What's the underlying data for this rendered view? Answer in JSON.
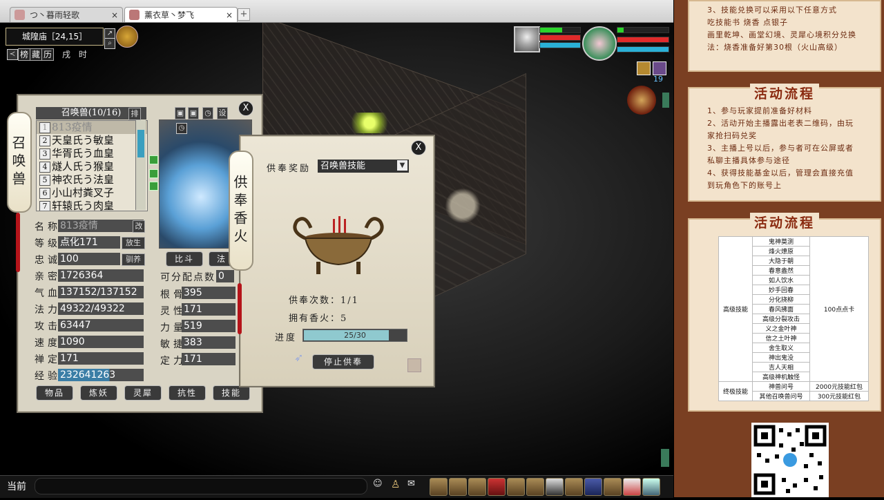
{
  "browser": {
    "tabs": [
      {
        "label": "つ丶暮雨轻歌"
      },
      {
        "label": "薰衣草丶梦飞"
      }
    ],
    "new_tab": "+"
  },
  "hud": {
    "location": "城隍庙［24,15］",
    "shortcut_labels": [
      "榜",
      "藏",
      "历"
    ],
    "game_time": "戌 时",
    "pet_level_badge": "19"
  },
  "summon_panel": {
    "scroll_title": "召唤兽",
    "list_header": "召唤兽(10/16)",
    "sort_btn": "排",
    "lock_icons": [
      "▣",
      "▣",
      "◷",
      "设"
    ],
    "pets": [
      {
        "num": "1",
        "name": "813疫情"
      },
      {
        "num": "2",
        "name": "天皇氏う敏皇"
      },
      {
        "num": "3",
        "name": "华胥氏う血皇"
      },
      {
        "num": "4",
        "name": "燧人氏う猴皇"
      },
      {
        "num": "5",
        "name": "神农氏う法皇"
      },
      {
        "num": "6",
        "name": "小山村粪叉子"
      },
      {
        "num": "7",
        "name": "轩辕氏う肉皇"
      }
    ],
    "attrs_left": [
      {
        "label": "名称",
        "value": "813疫情",
        "btn": "改"
      },
      {
        "label": "等级",
        "value": "点化171",
        "btn": "放生"
      },
      {
        "label": "忠诚",
        "value": "100",
        "btn": "驯养"
      },
      {
        "label": "亲密",
        "value": "1726364"
      },
      {
        "label": "气血",
        "value": "137152/137152"
      },
      {
        "label": "法力",
        "value": "49322/49322"
      },
      {
        "label": "攻击",
        "value": "63447"
      },
      {
        "label": "速度",
        "value": "1090"
      },
      {
        "label": "禅定",
        "value": "171"
      },
      {
        "label": "经验",
        "value": "232641263"
      }
    ],
    "mid_buttons": [
      "比斗",
      "法"
    ],
    "free_points_label": "可分配点数",
    "free_points_value": "0",
    "attrs_right": [
      {
        "label": "根骨",
        "value": "395"
      },
      {
        "label": "灵性",
        "value": "171"
      },
      {
        "label": "力量",
        "value": "519"
      },
      {
        "label": "敏捷",
        "value": "383"
      },
      {
        "label": "定力",
        "value": "171"
      }
    ],
    "bottom_buttons": [
      "物品",
      "炼妖",
      "灵犀",
      "抗性",
      "技能"
    ],
    "close": "X"
  },
  "offering_panel": {
    "scroll_title": "供奉香火",
    "reward_label": "供奉奖励",
    "reward_value": "召唤兽技能",
    "count_label": "供奉次数：",
    "count_value": "1/1",
    "incense_label": "拥有香火：",
    "incense_value": "5",
    "progress_label": "进度",
    "progress_text": "25/30",
    "progress": {
      "current": 25,
      "max": 30
    },
    "stop_button": "停止供奉",
    "close": "X"
  },
  "bottom_bar": {
    "chat_label": "当前"
  },
  "right_panel": {
    "top_lines": [
      "3、技能兑换可以采用以下任意方式",
      "吃技能书        烧香        点银子",
      "画里乾坤、画堂幻境、灵犀心境积分兑换",
      "法：烧香准备好第30根（火山高级）"
    ],
    "section1_title": "活动流程",
    "section1_lines": [
      "1、参与玩家提前准备好材料",
      "2、活动开始主播露出老表二维码，由玩",
      "家抢扫码兑奖",
      "3、主播上号以后，参与者可在公屏或者",
      "私聊主播具体参与途径",
      "4、获得技能基金以后，管理会直接充值",
      "到玩角色下的账号上"
    ],
    "section2_title": "活动流程",
    "table": {
      "group1_label": "高级技能",
      "group1_reward": "100点点卡",
      "group1_skills": [
        "鬼神莫测",
        "烽火燎原",
        "大隐于朝",
        "春意盎然",
        "如人饮水",
        "妙手回春",
        "分化挠柳",
        "春风拂面",
        "高级分裂攻击",
        "义之金叶神",
        "信之土叶神",
        "舍生取义",
        "神出鬼没",
        "吉人天相",
        "高级神机触怪"
      ],
      "group2_label": "终极技能",
      "group2_rows": [
        {
          "skill": "神兽问号",
          "reward": "2000元技能红包"
        },
        {
          "skill": "其他召唤兽问号",
          "reward": "300元技能红包"
        }
      ]
    }
  }
}
